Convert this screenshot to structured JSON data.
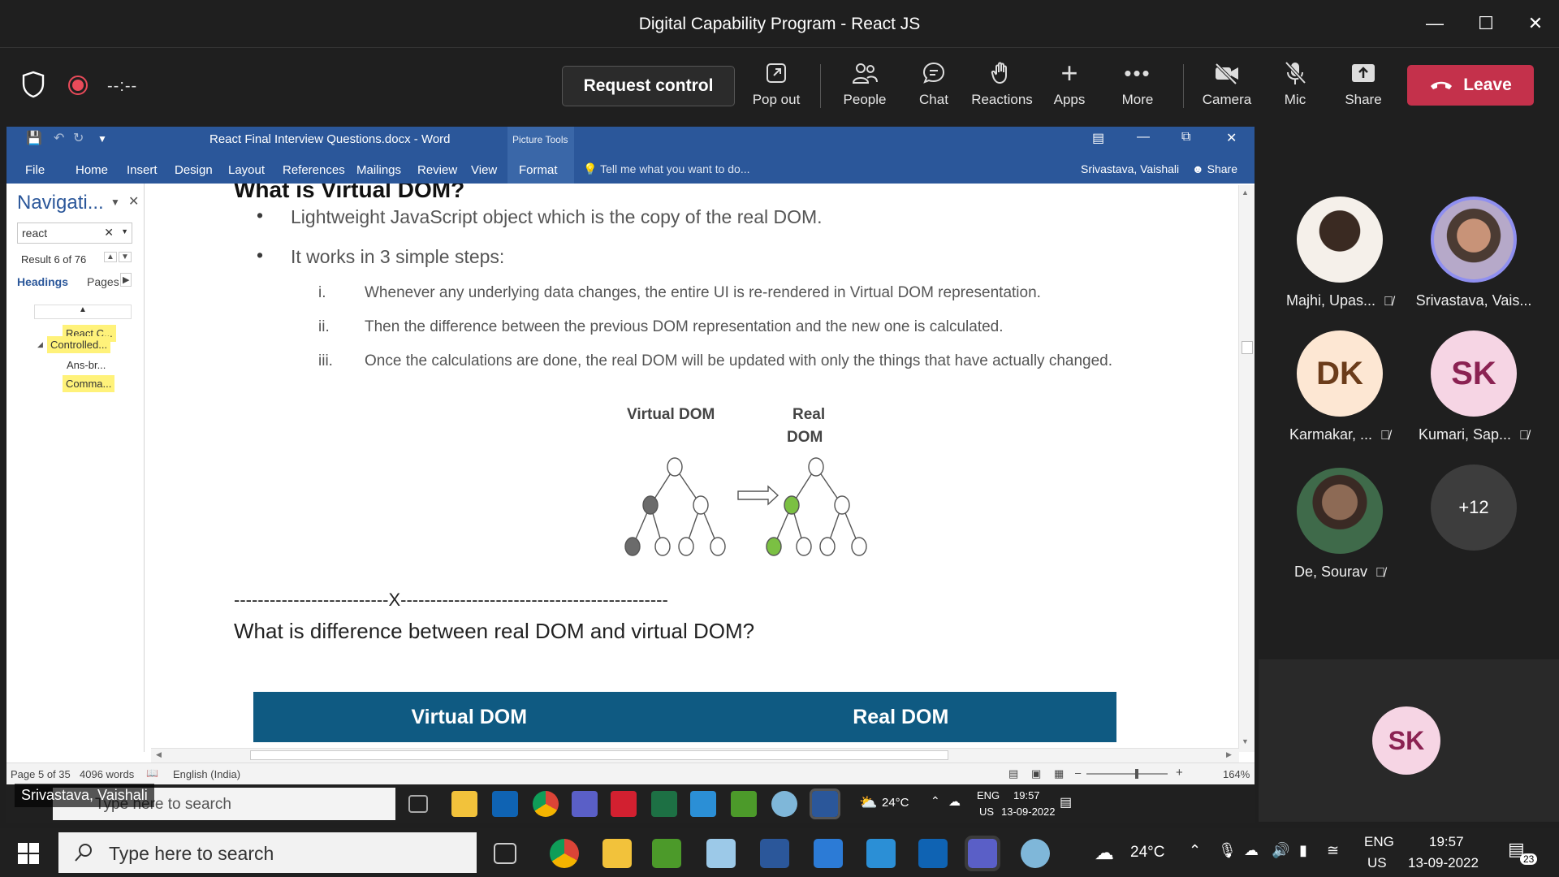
{
  "window": {
    "title": "Digital Capability Program - React JS"
  },
  "meeting": {
    "timer": "--:--",
    "request_control": "Request control",
    "buttons": {
      "popout": "Pop out",
      "people": "People",
      "chat": "Chat",
      "reactions": "Reactions",
      "apps": "Apps",
      "more": "More",
      "camera": "Camera",
      "mic": "Mic",
      "share": "Share"
    },
    "leave": "Leave"
  },
  "word": {
    "doc_title": "React Final Interview Questions.docx - Word",
    "picture_tools": "Picture Tools",
    "menu": [
      "File",
      "Home",
      "Insert",
      "Design",
      "Layout",
      "References",
      "Mailings",
      "Review",
      "View",
      "Format"
    ],
    "tell_me": "Tell me what you want to do...",
    "user": "Srivastava, Vaishali",
    "share": "Share",
    "nav": {
      "title": "Navigati...",
      "search_value": "react",
      "result": "Result 6 of 76",
      "tab_headings": "Headings",
      "tab_pages": "Pages",
      "headings": [
        "React C...",
        "Controlled...",
        "Ans-br...",
        "Comma..."
      ]
    },
    "doc": {
      "heading_partial": "What is Virtual DOM?",
      "bullets": [
        "Lightweight JavaScript object which is the copy of the real DOM.",
        "It works in 3 simple steps:"
      ],
      "steps": [
        {
          "num": "i.",
          "text": "Whenever any underlying data changes, the entire UI is re-rendered in Virtual DOM representation."
        },
        {
          "num": "ii.",
          "text": "Then the difference between the previous DOM representation and the new one is calculated."
        },
        {
          "num": "iii.",
          "text": "Once the calculations are done, the real DOM will be updated with only the things that have actually changed."
        }
      ],
      "diagram_left": "Virtual DOM",
      "diagram_right_1": "Real",
      "diagram_right_2": "DOM",
      "separator": "--------------------------X---------------------------------------------",
      "question": "What is difference between real DOM and virtual DOM?",
      "table_headers": [
        "Virtual DOM",
        "Real DOM"
      ]
    },
    "status": {
      "page": "Page 5 of 35",
      "words": "4096 words",
      "language": "English (India)",
      "zoom": "164%"
    },
    "inner_taskbar": {
      "search": "Type here to search",
      "temp": "24°C",
      "lang1": "ENG",
      "lang2": "US",
      "time": "19:57",
      "date": "13-09-2022"
    }
  },
  "presenter_tag": "Srivastava, Vaishali",
  "participants": [
    {
      "name": "Majhi, Upas...",
      "initials": "",
      "muted": true
    },
    {
      "name": "Srivastava, Vais...",
      "initials": "",
      "muted": false
    },
    {
      "name": "Karmakar, ...",
      "initials": "DK",
      "muted": true
    },
    {
      "name": "Kumari, Sap...",
      "initials": "SK",
      "muted": true
    },
    {
      "name": "De, Sourav",
      "initials": "",
      "muted": true
    },
    {
      "name": "",
      "initials": "+12",
      "muted": false
    }
  ],
  "self_tile": {
    "initials": "SK"
  },
  "taskbar": {
    "search": "Type here to search",
    "temp": "24°C",
    "lang1": "ENG",
    "lang2": "US",
    "time": "19:57",
    "date": "13-09-2022",
    "notifications": "23"
  }
}
